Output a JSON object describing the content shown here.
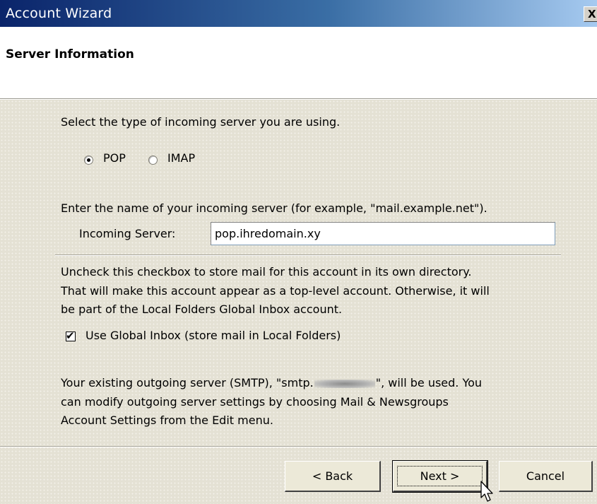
{
  "window": {
    "title": "Account Wizard",
    "close_glyph": "X"
  },
  "header": {
    "section_title": "Server Information"
  },
  "server_type": {
    "prompt": "Select the type of incoming server you are using.",
    "options": [
      {
        "label": "POP",
        "selected": true
      },
      {
        "label": "IMAP",
        "selected": false
      }
    ]
  },
  "incoming": {
    "prompt": "Enter the name of your incoming server (for example, \"mail.example.net\").",
    "label": "Incoming Server:",
    "value": "pop.ihredomain.xy"
  },
  "global_inbox": {
    "description_lines": [
      "Uncheck this checkbox to store mail for this account in its own directory.",
      "That will make this account appear as a top-level account. Otherwise, it will",
      "be part of the Local Folders Global Inbox account."
    ],
    "checkbox_label": "Use Global Inbox (store mail in Local Folders)",
    "checked": true
  },
  "smtp": {
    "line1_prefix": "Your existing outgoing server (SMTP), \"smtp.",
    "line1_suffix": "\", will be used. You",
    "line2": "can modify outgoing server settings by choosing Mail & Newsgroups",
    "line3": "Account Settings from the Edit menu."
  },
  "buttons": {
    "back": "< Back",
    "next": "Next >",
    "cancel": "Cancel"
  },
  "icons": {
    "close": "close-icon",
    "cursor": "mouse-pointer-icon",
    "check": "checkmark-icon"
  }
}
